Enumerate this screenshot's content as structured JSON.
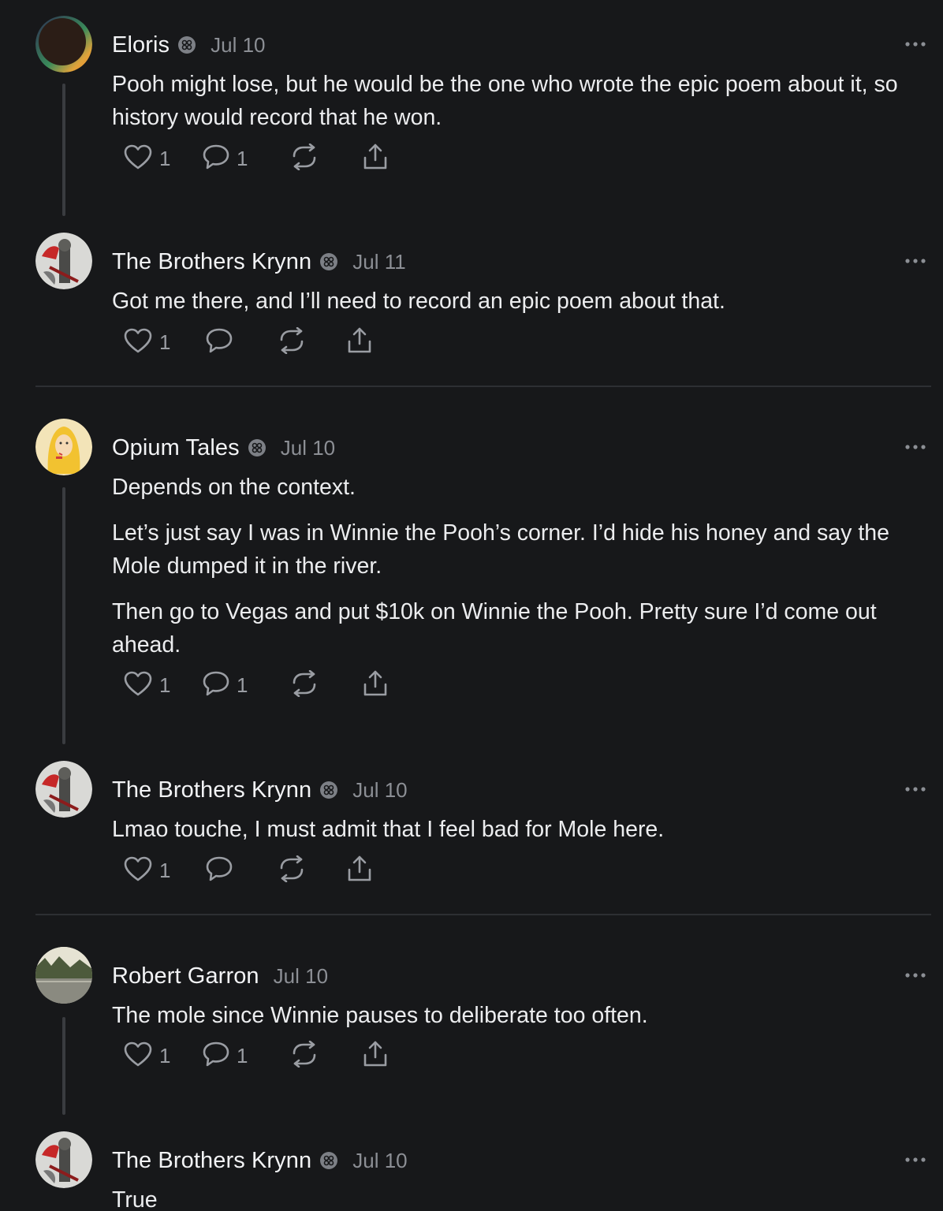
{
  "posts": [
    {
      "author": "Eloris",
      "date": "Jul 10",
      "paragraphs": [
        "Pooh might lose, but he would be the one who wrote the epic poem about it, so history would record that he won."
      ],
      "likes": "1",
      "comments": "1"
    },
    {
      "author": "The Brothers Krynn",
      "date": "Jul 11",
      "paragraphs": [
        "Got me there, and I’ll need to record an epic poem about that."
      ],
      "likes": "1",
      "comments": ""
    },
    {
      "author": "Opium Tales",
      "date": "Jul 10",
      "paragraphs": [
        "Depends on the context.",
        "Let’s just say I was in Winnie the Pooh’s corner. I’d hide his honey and say the Mole dumped it in the river.",
        "Then go to Vegas and put $10k on Winnie the Pooh. Pretty sure I’d come out ahead."
      ],
      "likes": "1",
      "comments": "1"
    },
    {
      "author": "The Brothers Krynn",
      "date": "Jul 10",
      "paragraphs": [
        "Lmao touche, I must admit that I feel bad for Mole here."
      ],
      "likes": "1",
      "comments": ""
    },
    {
      "author": "Robert Garron",
      "date": "Jul 10",
      "paragraphs": [
        "The mole since Winnie pauses to deliberate too often."
      ],
      "likes": "1",
      "comments": "1"
    },
    {
      "author": "The Brothers Krynn",
      "date": "Jul 10",
      "paragraphs": [
        "True"
      ],
      "likes": "",
      "comments": ""
    }
  ],
  "icons": {
    "like": "heart-icon",
    "comment": "comment-bubble-icon",
    "restack": "restack-icon",
    "share": "share-icon",
    "more": "more-options-icon",
    "badge": "subscriber-badge-icon"
  },
  "colors": {
    "background": "#17181a",
    "text": "#ecedef",
    "muted": "#8c8f95",
    "icon": "#9a9da3",
    "divider": "#2d2f33"
  }
}
